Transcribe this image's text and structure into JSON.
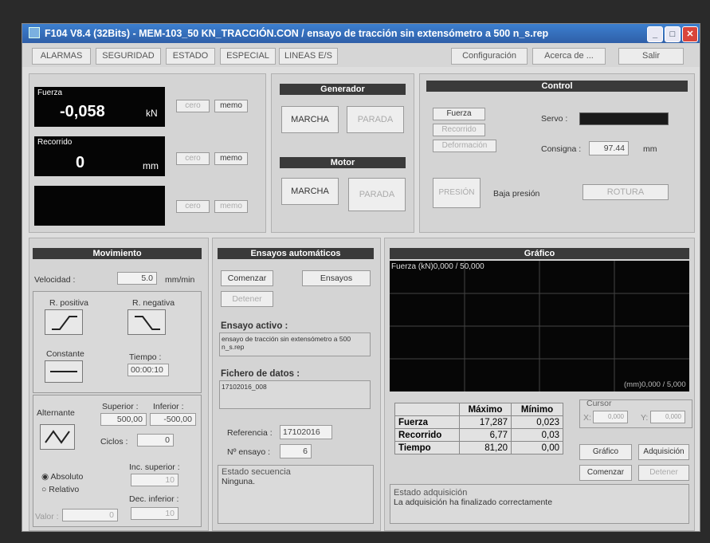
{
  "window": {
    "title": "F104 V8.4 (32Bits) - MEM-103_50 KN_TRACCIÓN.CON / ensayo de tracción sin extensómetro a 500 n_s.rep"
  },
  "menu": {
    "alarmas": "ALARMAS",
    "seguridad": "SEGURIDAD",
    "estado": "ESTADO",
    "especial": "ESPECIAL",
    "lineas": "LINEAS E/S",
    "configuracion": "Configuración",
    "acerca": "Acerca de ...",
    "salir": "Salir"
  },
  "readouts": {
    "fuerza": {
      "label": "Fuerza",
      "value": "-0,058",
      "unit": "kN"
    },
    "recorrido": {
      "label": "Recorrido",
      "value": "0",
      "unit": "mm"
    },
    "cero": "cero",
    "memo": "memo"
  },
  "generador": {
    "title": "Generador",
    "marcha": "MARCHA",
    "parada": "PARADA"
  },
  "motor": {
    "title": "Motor",
    "marcha": "MARCHA",
    "parada": "PARADA"
  },
  "control": {
    "title": "Control",
    "fuerza": "Fuerza",
    "recorrido": "Recorrido",
    "deformacion": "Deformación",
    "servo_label": "Servo :",
    "consigna_label": "Consigna :",
    "consigna_value": "97.44",
    "consigna_unit": "mm",
    "presion": "PRESIÓN",
    "baja_presion": "Baja presión",
    "rotura": "ROTURA"
  },
  "movimiento": {
    "title": "Movimiento",
    "velocidad_label": "Velocidad :",
    "velocidad_value": "5.0",
    "velocidad_unit": "mm/min",
    "r_positiva": "R. positiva",
    "r_negativa": "R. negativa",
    "constante": "Constante",
    "tiempo_label": "Tiempo :",
    "tiempo_value": "00:00:10",
    "alternante": "Alternante",
    "superior_label": "Superior :",
    "inferior_label": "Inferior :",
    "superior_value": "500,00",
    "inferior_value": "-500,00",
    "ciclos_label": "Ciclos :",
    "ciclos_value": "0",
    "absoluto": "Absoluto",
    "relativo": "Relativo",
    "inc_superior": "Inc. superior :",
    "inc_value": "10",
    "dec_inferior": "Dec. inferior :",
    "dec_value": "10",
    "valor_label": "Valor :",
    "valor_value": "0"
  },
  "ensayos": {
    "title": "Ensayos automáticos",
    "comenzar": "Comenzar",
    "ensayos": "Ensayos",
    "detener": "Detener",
    "activo_label": "Ensayo activo :",
    "activo_value": "ensayo de tracción sin extensómetro a 500 n_s.rep",
    "fichero_label": "Fichero de datos :",
    "fichero_value": "17102016_008",
    "referencia_label": "Referencia :",
    "referencia_value": "17102016",
    "n_ensayo_label": "Nº ensayo :",
    "n_ensayo_value": "6",
    "estado_label": "Estado secuencia",
    "estado_value": "Ninguna."
  },
  "grafico": {
    "title": "Gráfico",
    "y_label": "Fuerza (kN)0,000 / 50,000",
    "x_label": "(mm)0,000 / 5,000",
    "cursor_label": "Cursor",
    "x_cursor_label": "X:",
    "x_cursor_value": "0,000",
    "y_cursor_label": "Y:",
    "y_cursor_value": "0,000",
    "grafico_btn": "Gráfico",
    "adquisicion_btn": "Adquisición",
    "comenzar_btn": "Comenzar",
    "detener_btn": "Detener",
    "estado_label": "Estado adquisición",
    "estado_value": "La adquisición ha finalizado correctamente",
    "table": {
      "headers": [
        "",
        "Máximo",
        "Mínimo"
      ],
      "rows": [
        [
          "Fuerza",
          "17,287",
          "0,023"
        ],
        [
          "Recorrido",
          "6,77",
          "0,03"
        ],
        [
          "Tiempo",
          "81,20",
          "0,00"
        ]
      ]
    }
  },
  "colors": {
    "panel_header": "#3a3a3a",
    "title_bar": "#2f5fa8",
    "lcd": "#050505"
  }
}
